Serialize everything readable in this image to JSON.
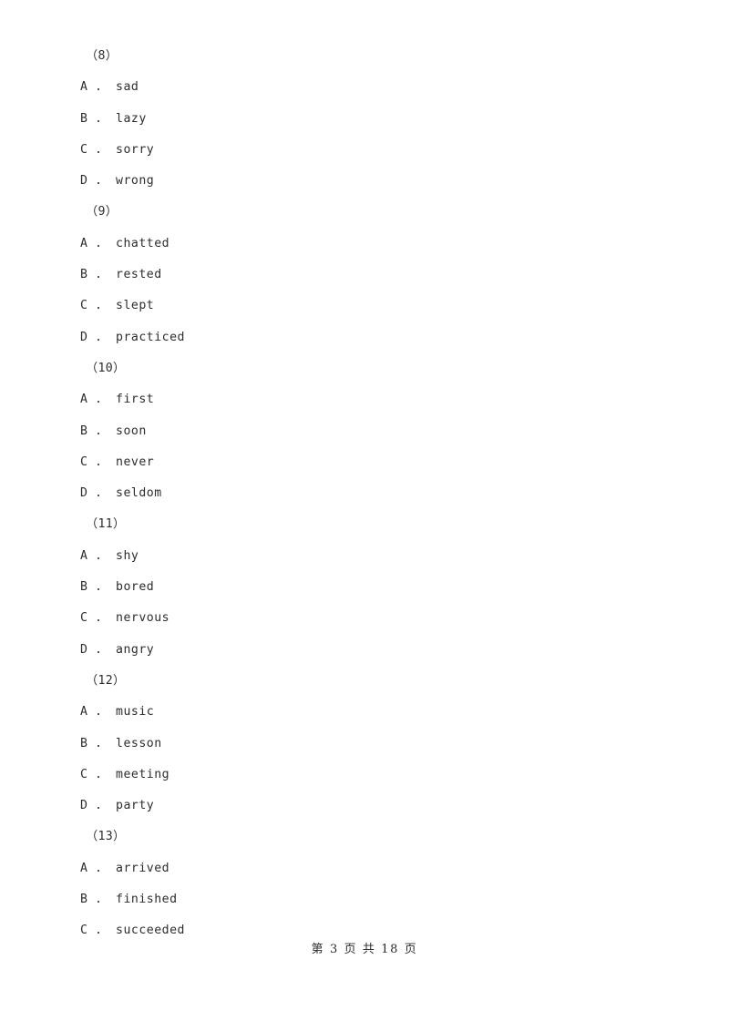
{
  "document": {
    "background_color": "#ffffff",
    "text_color": "#2d2d2d",
    "lines": [
      {
        "kind": "question-number",
        "text": "（8）"
      },
      {
        "kind": "option",
        "text": "A ． sad"
      },
      {
        "kind": "option",
        "text": "B ． lazy"
      },
      {
        "kind": "option",
        "text": "C ． sorry"
      },
      {
        "kind": "option",
        "text": "D ． wrong"
      },
      {
        "kind": "question-number",
        "text": "（9）"
      },
      {
        "kind": "option",
        "text": "A ． chatted"
      },
      {
        "kind": "option",
        "text": "B ． rested"
      },
      {
        "kind": "option",
        "text": "C ． slept"
      },
      {
        "kind": "option",
        "text": "D ． practiced"
      },
      {
        "kind": "question-number",
        "text": "（10）"
      },
      {
        "kind": "option",
        "text": "A ． first"
      },
      {
        "kind": "option",
        "text": "B ． soon"
      },
      {
        "kind": "option",
        "text": "C ． never"
      },
      {
        "kind": "option",
        "text": "D ． seldom"
      },
      {
        "kind": "question-number",
        "text": "（11）"
      },
      {
        "kind": "option",
        "text": "A ． shy"
      },
      {
        "kind": "option",
        "text": "B ． bored"
      },
      {
        "kind": "option",
        "text": "C ． nervous"
      },
      {
        "kind": "option",
        "text": "D ． angry"
      },
      {
        "kind": "question-number",
        "text": "（12）"
      },
      {
        "kind": "option",
        "text": "A ． music"
      },
      {
        "kind": "option",
        "text": "B ． lesson"
      },
      {
        "kind": "option",
        "text": "C ． meeting"
      },
      {
        "kind": "option",
        "text": "D ． party"
      },
      {
        "kind": "question-number",
        "text": "（13）"
      },
      {
        "kind": "option",
        "text": "A ． arrived"
      },
      {
        "kind": "option",
        "text": "B ． finished"
      },
      {
        "kind": "option",
        "text": "C ． succeeded"
      }
    ]
  },
  "footer": {
    "page_label": "第 3 页 共 18 页",
    "current_page": "3",
    "total_pages": "18"
  }
}
